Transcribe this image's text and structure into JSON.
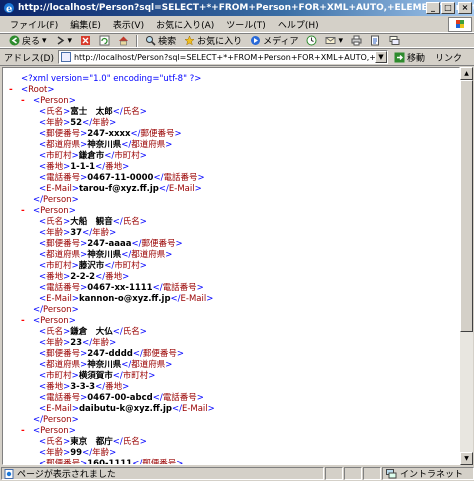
{
  "window": {
    "title": "http://localhost/Person?sql=SELECT+*+FROM+Person+FOR+XML+AUTO,+ELEMENTS&root=Root - Microsoft Internet Explorer",
    "minimize": "_",
    "maximize": "□",
    "close": "×"
  },
  "menu": [
    "ファイル(F)",
    "編集(E)",
    "表示(V)",
    "お気に入り(A)",
    "ツール(T)",
    "ヘルプ(H)"
  ],
  "toolbar": {
    "back": "戻る",
    "search": "検索",
    "favorites": "お気に入り",
    "media": "メディア"
  },
  "address": {
    "label": "アドレス(D)",
    "url": "http://localhost/Person?sql=SELECT+*+FROM+Person+FOR+XML+AUTO,+ELEMENTS&root=Root",
    "go": "移動",
    "links": "リンク"
  },
  "xml": {
    "declaration": "<?xml version=\"1.0\" encoding=\"utf-8\" ?>",
    "root": "Root",
    "record_tag": "Person",
    "persons": [
      {
        "fields": [
          {
            "tag": "氏名",
            "value": "富士　太郎"
          },
          {
            "tag": "年齢",
            "value": "52"
          },
          {
            "tag": "郵便番号",
            "value": "247-xxxx"
          },
          {
            "tag": "都道府県",
            "value": "神奈川県"
          },
          {
            "tag": "市町村",
            "value": "鎌倉市"
          },
          {
            "tag": "番地",
            "value": "1-1-1"
          },
          {
            "tag": "電話番号",
            "value": "0467-11-0000"
          },
          {
            "tag": "E-Mail",
            "value": "tarou-f@xyz.ff.jp"
          }
        ]
      },
      {
        "fields": [
          {
            "tag": "氏名",
            "value": "大船　観音"
          },
          {
            "tag": "年齢",
            "value": "37"
          },
          {
            "tag": "郵便番号",
            "value": "247-aaaa"
          },
          {
            "tag": "都道府県",
            "value": "神奈川県"
          },
          {
            "tag": "市町村",
            "value": "藤沢市"
          },
          {
            "tag": "番地",
            "value": "2-2-2"
          },
          {
            "tag": "電話番号",
            "value": "0467-xx-1111"
          },
          {
            "tag": "E-Mail",
            "value": "kannon-o@xyz.ff.jp"
          }
        ]
      },
      {
        "fields": [
          {
            "tag": "氏名",
            "value": "鎌倉　大仏"
          },
          {
            "tag": "年齢",
            "value": "23"
          },
          {
            "tag": "郵便番号",
            "value": "247-dddd"
          },
          {
            "tag": "都道府県",
            "value": "神奈川県"
          },
          {
            "tag": "市町村",
            "value": "横須賀市"
          },
          {
            "tag": "番地",
            "value": "3-3-3"
          },
          {
            "tag": "電話番号",
            "value": "0467-00-abcd"
          },
          {
            "tag": "E-Mail",
            "value": "daibutu-k@xyz.ff.jp"
          }
        ]
      },
      {
        "fields": [
          {
            "tag": "氏名",
            "value": "東京　都庁"
          },
          {
            "tag": "年齢",
            "value": "99"
          },
          {
            "tag": "郵便番号",
            "value": "160-1111"
          }
        ]
      }
    ]
  },
  "status": {
    "message": "ページが表示されました",
    "zone": "イントラネット"
  },
  "colors": {
    "markup": "#0000ff",
    "tag_name": "#990000",
    "collapse_minus": "#ff0000",
    "title_gradient_start": "#0a246a"
  }
}
